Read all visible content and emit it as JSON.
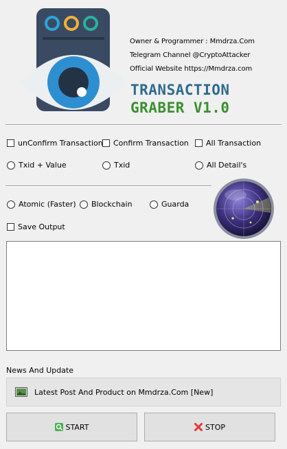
{
  "header": {
    "owner_line": "Owner & Programmer : Mmdrza.Com",
    "telegram_line": "Telegram Channel @CryptoAttacker",
    "website_line": "Official Website https://Mmdrza.com",
    "brand_line1": "TRANSACTION",
    "brand_line2": "GRABER V1.0",
    "brand_color1": "#2e6b8e",
    "brand_color2": "#3a8f2e"
  },
  "options": {
    "checkboxes": [
      {
        "label": "unConfirm Transaction",
        "checked": false
      },
      {
        "label": "Confirm Transaction",
        "checked": false
      },
      {
        "label": "All Transaction",
        "checked": false
      }
    ],
    "radios": [
      {
        "label": "Txid + Value",
        "selected": false
      },
      {
        "label": "Txid",
        "selected": false
      },
      {
        "label": "All Detail's",
        "selected": false
      }
    ]
  },
  "source": {
    "radios": [
      {
        "label": "Atomic (Faster)",
        "selected": false
      },
      {
        "label": "Blockchain",
        "selected": false
      },
      {
        "label": "Guarda",
        "selected": false
      }
    ],
    "save_output": {
      "label": "Save Output",
      "checked": false
    }
  },
  "output": {
    "value": ""
  },
  "news": {
    "heading": "News And Update",
    "item": "Latest Post And Product on Mmdrza.Com [New]"
  },
  "buttons": {
    "start_label": "START",
    "stop_label": "STOP"
  }
}
